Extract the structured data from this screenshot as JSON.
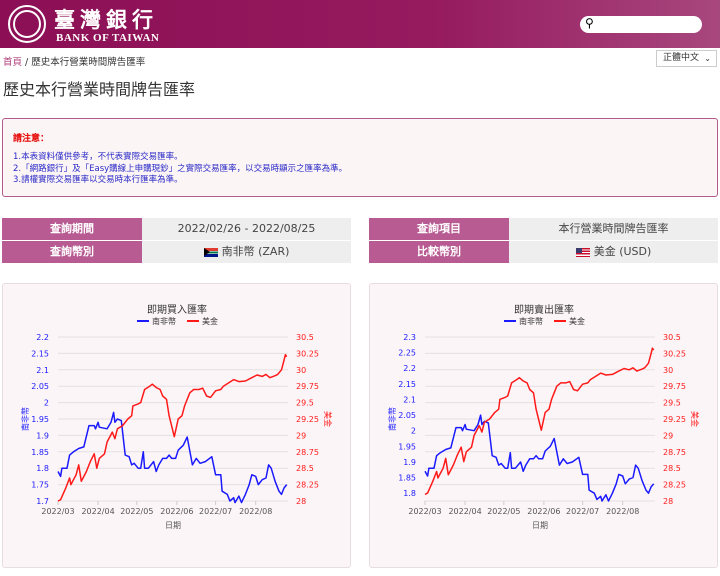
{
  "header": {
    "brand_zh": "臺灣銀行",
    "brand_en": "BANK OF TAIWAN",
    "logo_glyph": "台",
    "search_placeholder": ""
  },
  "breadcrumb": {
    "home": "首頁",
    "sep": "/",
    "current": "歷史本行營業時間牌告匯率"
  },
  "language": {
    "selected": "正體中文"
  },
  "page_title": "歷史本行營業時間牌告匯率",
  "notice": {
    "heading": "請注意：",
    "lines": [
      "1.本表資料僅供參考，不代表實際交易匯率。",
      "2.「網路銀行」及「Easy購線上申購現鈔」之實際交易匯率，以交易時顯示之匯率為準。",
      "3.請權實際交易匯率以交易時本行匯率為準。"
    ]
  },
  "query_left": {
    "period_label": "查詢期間",
    "period_value": "2022/02/26 - 2022/08/25",
    "currency_label": "查詢幣別",
    "currency_value": "南非幣 (ZAR)"
  },
  "query_right": {
    "item_label": "查詢項目",
    "item_value": "本行營業時間牌告匯率",
    "compare_label": "比較幣別",
    "compare_value": "美金 (USD)"
  },
  "colors": {
    "zar": "#1a1aff",
    "usd": "#ff1a1a",
    "brand": "#8c0f55",
    "label": "#b85b92"
  },
  "chart_data": [
    {
      "type": "line",
      "title": "即期買入匯率",
      "xlabel": "日期",
      "ylabel_left": "南非幣",
      "ylabel_right": "美金",
      "x_ticks": [
        "2022/03",
        "2022/04",
        "2022/05",
        "2022/06",
        "2022/07",
        "2022/08"
      ],
      "ylim_left": [
        1.7,
        2.2
      ],
      "yticks_left": [
        "1.7",
        "1.75",
        "1.8",
        "1.85",
        "1.9",
        "1.95",
        "2",
        "2.05",
        "2.1",
        "2.15",
        "2.2"
      ],
      "ylim_right": [
        28,
        30.5
      ],
      "yticks_right": [
        "28",
        "28.25",
        "28.5",
        "28.75",
        "29",
        "29.25",
        "29.5",
        "29.75",
        "30",
        "30.25",
        "30.5"
      ],
      "legend": [
        "南非幣",
        "美金"
      ],
      "series": [
        {
          "name": "南非幣",
          "axis": "left",
          "days": [
            0,
            2,
            3,
            7,
            9,
            12,
            16,
            20,
            24,
            28,
            29,
            31,
            32,
            38,
            41,
            43,
            44,
            46,
            49,
            52,
            55,
            57,
            59,
            62,
            64,
            66,
            67,
            70,
            74,
            76,
            78,
            81,
            84,
            86,
            88,
            91,
            93,
            97,
            100,
            104,
            107,
            110,
            114,
            119,
            122,
            126,
            127,
            131,
            133,
            136,
            137,
            140,
            142,
            145,
            148,
            150,
            153,
            155,
            158,
            161,
            163,
            165,
            168,
            171,
            173,
            175,
            177
          ],
          "values": [
            1.79,
            1.775,
            1.8,
            1.8,
            1.84,
            1.85,
            1.86,
            1.865,
            1.93,
            1.93,
            1.92,
            1.94,
            1.925,
            1.92,
            1.94,
            1.97,
            1.94,
            1.95,
            1.945,
            1.84,
            1.835,
            1.81,
            1.815,
            1.8,
            1.8,
            1.85,
            1.8,
            1.8,
            1.82,
            1.79,
            1.81,
            1.83,
            1.83,
            1.84,
            1.83,
            1.83,
            1.855,
            1.87,
            1.895,
            1.81,
            1.83,
            1.815,
            1.82,
            1.835,
            1.78,
            1.78,
            1.73,
            1.72,
            1.7,
            1.71,
            1.695,
            1.715,
            1.695,
            1.72,
            1.75,
            1.78,
            1.775,
            1.75,
            1.765,
            1.77,
            1.81,
            1.8,
            1.76,
            1.73,
            1.72,
            1.74,
            1.75
          ]
        },
        {
          "name": "美金",
          "axis": "right",
          "days": [
            0,
            2,
            6,
            9,
            10,
            14,
            16,
            18,
            22,
            25,
            28,
            30,
            32,
            36,
            38,
            42,
            44,
            46,
            50,
            54,
            57,
            58,
            62,
            64,
            67,
            71,
            73,
            76,
            79,
            81,
            84,
            86,
            90,
            93,
            96,
            98,
            102,
            105,
            109,
            112,
            115,
            118,
            122,
            126,
            128,
            132,
            136,
            140,
            145,
            150,
            154,
            158,
            161,
            164,
            168,
            170,
            173,
            175,
            176,
            177
          ],
          "values": [
            28.0,
            28.02,
            28.2,
            28.35,
            28.25,
            28.4,
            28.55,
            28.3,
            28.45,
            28.6,
            28.72,
            28.5,
            28.65,
            28.72,
            28.9,
            29.05,
            28.95,
            29.1,
            29.15,
            29.25,
            29.3,
            29.45,
            29.48,
            29.5,
            29.7,
            29.75,
            29.78,
            29.73,
            29.7,
            29.6,
            29.55,
            29.3,
            28.98,
            29.25,
            29.3,
            29.45,
            29.65,
            29.7,
            29.7,
            29.72,
            29.6,
            29.58,
            29.68,
            29.7,
            29.75,
            29.8,
            29.85,
            29.82,
            29.83,
            29.88,
            29.92,
            29.9,
            29.93,
            29.88,
            29.91,
            29.93,
            30.0,
            30.15,
            30.23,
            30.2
          ]
        }
      ]
    },
    {
      "type": "line",
      "title": "即期賣出匯率",
      "xlabel": "日期",
      "ylabel_left": "南非幣",
      "ylabel_right": "美金",
      "x_ticks": [
        "2022/03",
        "2022/04",
        "2022/05",
        "2022/06",
        "2022/07",
        "2022/08"
      ],
      "ylim_left": [
        1.775,
        2.3
      ],
      "yticks_left": [
        "1.8",
        "1.85",
        "1.9",
        "1.95",
        "2",
        "2.05",
        "2.1",
        "2.15",
        "2.2",
        "2.25",
        "2.3"
      ],
      "ylim_right": [
        28,
        30.5
      ],
      "yticks_right": [
        "28",
        "28.25",
        "28.5",
        "28.75",
        "29",
        "29.25",
        "29.5",
        "29.75",
        "30",
        "30.25",
        "30.5"
      ],
      "legend": [
        "南非幣",
        "美金"
      ],
      "series": [
        {
          "name": "南非幣",
          "axis": "left",
          "days": [
            0,
            2,
            3,
            7,
            9,
            12,
            16,
            20,
            24,
            28,
            29,
            31,
            32,
            38,
            41,
            43,
            44,
            46,
            49,
            52,
            55,
            57,
            59,
            62,
            64,
            66,
            67,
            70,
            74,
            76,
            78,
            81,
            84,
            86,
            88,
            91,
            93,
            97,
            100,
            104,
            107,
            110,
            114,
            119,
            122,
            126,
            127,
            131,
            133,
            136,
            137,
            140,
            142,
            145,
            148,
            150,
            153,
            155,
            158,
            161,
            163,
            165,
            168,
            171,
            173,
            175,
            177
          ],
          "values": [
            1.87,
            1.855,
            1.88,
            1.88,
            1.92,
            1.93,
            1.94,
            1.945,
            2.01,
            2.01,
            2.0,
            2.02,
            2.005,
            2.0,
            2.02,
            2.05,
            2.02,
            2.03,
            2.025,
            1.92,
            1.915,
            1.89,
            1.895,
            1.88,
            1.88,
            1.93,
            1.88,
            1.88,
            1.9,
            1.87,
            1.89,
            1.91,
            1.91,
            1.92,
            1.91,
            1.91,
            1.935,
            1.95,
            1.975,
            1.89,
            1.91,
            1.895,
            1.9,
            1.915,
            1.86,
            1.86,
            1.81,
            1.8,
            1.78,
            1.79,
            1.775,
            1.795,
            1.775,
            1.8,
            1.83,
            1.86,
            1.855,
            1.83,
            1.845,
            1.85,
            1.89,
            1.88,
            1.84,
            1.81,
            1.8,
            1.82,
            1.83
          ]
        },
        {
          "name": "美金",
          "axis": "right",
          "days": [
            0,
            2,
            6,
            9,
            10,
            14,
            16,
            18,
            22,
            25,
            28,
            30,
            32,
            36,
            38,
            42,
            44,
            46,
            50,
            54,
            57,
            58,
            62,
            64,
            67,
            71,
            73,
            76,
            79,
            81,
            84,
            86,
            90,
            93,
            96,
            98,
            102,
            105,
            109,
            112,
            115,
            118,
            122,
            126,
            128,
            132,
            136,
            140,
            145,
            150,
            154,
            158,
            161,
            164,
            168,
            170,
            173,
            175,
            176,
            177
          ],
          "values": [
            28.1,
            28.12,
            28.3,
            28.45,
            28.35,
            28.5,
            28.65,
            28.4,
            28.55,
            28.7,
            28.82,
            28.6,
            28.75,
            28.82,
            29.0,
            29.15,
            29.05,
            29.2,
            29.25,
            29.35,
            29.4,
            29.55,
            29.58,
            29.6,
            29.8,
            29.85,
            29.88,
            29.83,
            29.8,
            29.7,
            29.65,
            29.4,
            29.08,
            29.35,
            29.4,
            29.55,
            29.75,
            29.8,
            29.8,
            29.82,
            29.7,
            29.68,
            29.78,
            29.8,
            29.85,
            29.9,
            29.95,
            29.92,
            29.93,
            29.98,
            30.02,
            30.0,
            30.03,
            29.98,
            30.01,
            30.03,
            30.1,
            30.25,
            30.33,
            30.3
          ]
        }
      ]
    }
  ]
}
